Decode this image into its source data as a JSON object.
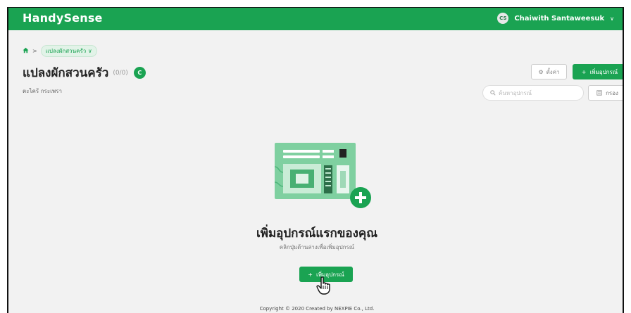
{
  "app": {
    "brand": "HandySense"
  },
  "user": {
    "initials": "CS",
    "name": "Chaiwith Santaweesuk"
  },
  "breadcrumb": {
    "current": "แปลงผักสวนครัว"
  },
  "page": {
    "title": "แปลงผักสวนครัว",
    "count": "(0/0)",
    "badge": "C",
    "subtitle": "ตะไคร้ กระเพรา"
  },
  "toolbar": {
    "settings_label": "ตั้งค่า",
    "add_label": "เพิ่มอุปกรณ์",
    "search_placeholder": "ค้นหาอุปกรณ์",
    "filter_label": "กรอง"
  },
  "empty_state": {
    "title": "เพิ่มอุปกรณ์แรกของคุณ",
    "subtitle": "คลิกปุ่มด้านล่างเพื่อเพิ่มอุปกรณ์",
    "button_label": "เพิ่มอุปกรณ์"
  },
  "footer": {
    "text": "Copyright © 2020 Created by NEXPIE Co., Ltd."
  },
  "colors": {
    "brand_green": "#1aa352",
    "background": "#f2f2f2"
  }
}
